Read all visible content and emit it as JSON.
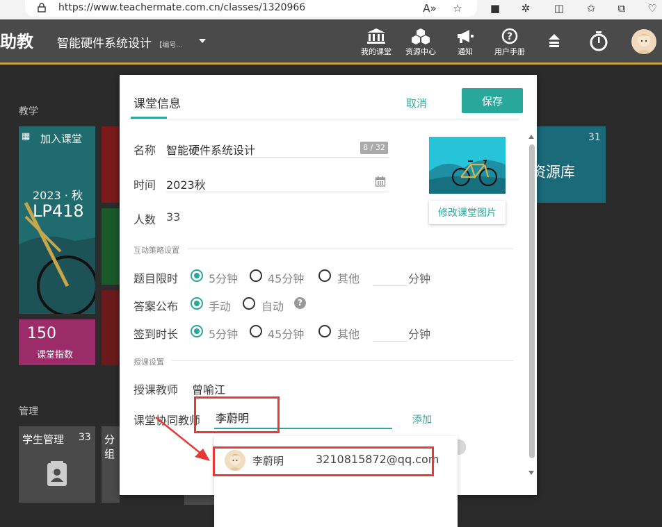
{
  "browser": {
    "url": "https://www.teachermate.com.cn/classes/1320966"
  },
  "header": {
    "brand": "助教",
    "course_name": "智能硬件系统设计",
    "course_code": "【编号...",
    "nav": [
      {
        "label": "我的课堂",
        "icon": "classroom-icon"
      },
      {
        "label": "资源中心",
        "icon": "resource-center-icon"
      },
      {
        "label": "通知",
        "icon": "megaphone-icon"
      },
      {
        "label": "用户手册",
        "icon": "help-icon"
      }
    ]
  },
  "dashboard": {
    "teaching_label": "教学",
    "join_class": "加入课堂",
    "term": "2023 · 秋",
    "room": "LP418",
    "index_value": "150",
    "index_label": "课堂指数",
    "resource_count": "31",
    "resource_label": "资源库",
    "manage_label": "管理",
    "student_manage": "学生管理",
    "student_count": "33",
    "group_label": "分组"
  },
  "modal": {
    "title": "课堂信息",
    "cancel": "取消",
    "save": "保存",
    "name_label": "名称",
    "name_value": "智能硬件系统设计",
    "name_counter": "8 / 32",
    "time_label": "时间",
    "time_value": "2023秋",
    "people_label": "人数",
    "people_value": "33",
    "change_image": "修改课堂图片",
    "section_interact": "互动策略设置",
    "q_limit_label": "题目限时",
    "q_limit_options": [
      "5分钟",
      "45分钟",
      "其他"
    ],
    "q_limit_selected": "5分钟",
    "answer_label": "答案公布",
    "answer_options": [
      "手动",
      "自动"
    ],
    "answer_selected": "手动",
    "checkin_label": "签到时长",
    "checkin_options": [
      "5分钟",
      "45分钟",
      "其他"
    ],
    "checkin_selected": "5分钟",
    "minute_unit": "分钟",
    "section_teaching": "授课设置",
    "teacher_label": "授课教师",
    "teacher_value": "曾喻江",
    "co_teacher_label": "课堂协同教师",
    "co_teacher_input": "李蔚明",
    "add": "添加"
  },
  "dropdown": {
    "name": "李蔚明",
    "email": "3210815872@qq.com"
  },
  "colors": {
    "accent": "#2aa79b",
    "annotation": "#e53935",
    "header_bg": "#4a4a4a"
  }
}
